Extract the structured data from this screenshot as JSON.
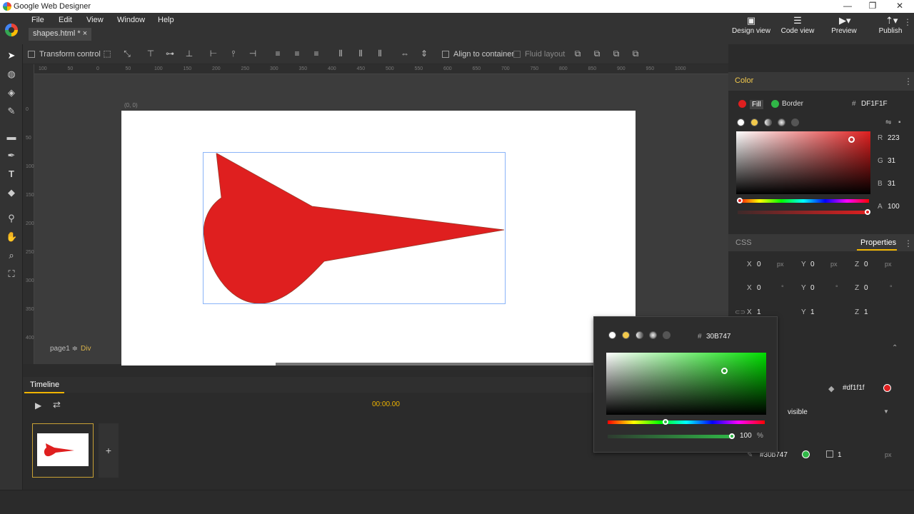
{
  "window": {
    "title": "Google Web Designer",
    "controls": [
      "—",
      "❐",
      "✕"
    ]
  },
  "menu": [
    "File",
    "Edit",
    "View",
    "Window",
    "Help"
  ],
  "document_tab": "shapes.html * ×",
  "view_buttons": [
    {
      "label": "Design view",
      "icon": "image-icon"
    },
    {
      "label": "Code view",
      "icon": "lines-icon"
    },
    {
      "label": "Preview",
      "icon": "play-icon"
    },
    {
      "label": "Publish",
      "icon": "upload-icon"
    }
  ],
  "toolbar": {
    "transform_control": "Transform control",
    "align_to_container": "Align to container",
    "fluid_layout": "Fluid layout"
  },
  "ruler_top": [
    "100",
    "50",
    "0",
    "50",
    "100",
    "150",
    "200",
    "250",
    "300",
    "350",
    "400",
    "450",
    "500",
    "550",
    "600",
    "650",
    "700",
    "750",
    "800",
    "850",
    "900",
    "950",
    "1000"
  ],
  "ruler_left": [
    "0",
    "50",
    "100",
    "150",
    "200",
    "250",
    "300",
    "350",
    "400"
  ],
  "canvas": {
    "origin": "(0, 0)",
    "page": "page1 ≑",
    "element": "Div",
    "shape_fill": "#DF1F1F"
  },
  "timeline": {
    "title": "Timeline",
    "time": "00:00.00",
    "add": "+"
  },
  "color_panel": {
    "title": "Color",
    "fill_label": "Fill",
    "border_label": "Border",
    "hex_prefix": "#",
    "hex": "DF1F1F",
    "r_label": "R",
    "r": "223",
    "g_label": "G",
    "g": "31",
    "b_label": "B",
    "b": "31",
    "a_label": "A",
    "a": "100"
  },
  "css_panel": {
    "css_tab": "CSS",
    "properties_tab": "Properties",
    "rows": [
      [
        {
          "l": "X",
          "v": "0",
          "u": "px"
        },
        {
          "l": "Y",
          "v": "0",
          "u": "px"
        },
        {
          "l": "Z",
          "v": "0",
          "u": "px"
        }
      ],
      [
        {
          "l": "X",
          "v": "0",
          "u": "°"
        },
        {
          "l": "Y",
          "v": "0",
          "u": "°"
        },
        {
          "l": "Z",
          "v": "0",
          "u": "°"
        }
      ],
      [
        {
          "l": "X",
          "v": "1",
          "u": ""
        },
        {
          "l": "Y",
          "v": "1",
          "u": ""
        },
        {
          "l": "Z",
          "v": "1",
          "u": ""
        }
      ]
    ],
    "fill_hex": "#df1f1f",
    "visibility": "visible",
    "border_hex": "#30b747",
    "border_width": "1",
    "border_unit": "px"
  },
  "popup": {
    "hex_prefix": "#",
    "hex": "30B747",
    "alpha": "100",
    "alpha_unit": "%"
  },
  "colors": {
    "fill": "#df1f1f",
    "border": "#30b747",
    "accent": "#f0b400"
  }
}
